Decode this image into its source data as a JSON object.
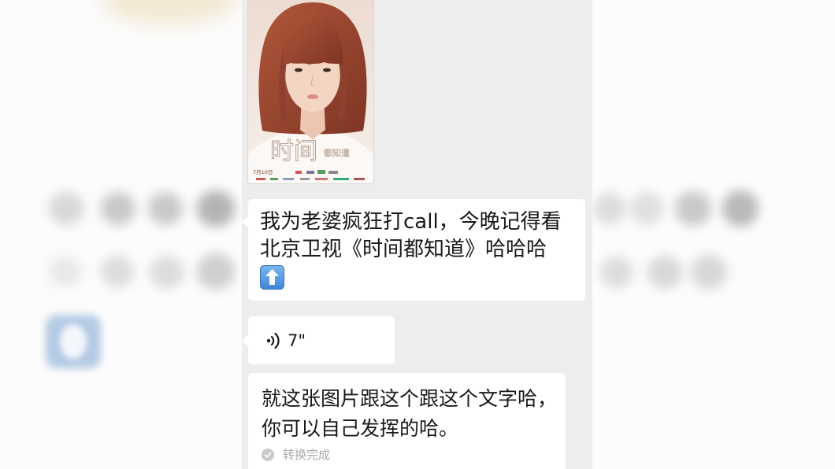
{
  "chat": {
    "image_message": {
      "poster": {
        "title_main": "时间",
        "title_sub": "都知道",
        "date": "7月10日"
      }
    },
    "text_message": {
      "lines": [
        "我为老婆疯狂打call，今晚记得看",
        "北京卫视《时间都知道》哈哈哈"
      ],
      "emoji_icon": "up-arrow-emoji-icon"
    },
    "voice_message": {
      "icon": "voice-wave-icon",
      "duration": "7\""
    },
    "voice_transcript": {
      "lines": [
        "就这张图片跟这个跟这个文字哈，",
        "你可以自己发挥的哈。"
      ],
      "status_icon": "check-circle-icon",
      "status_text": "转换完成"
    }
  },
  "colors": {
    "chat_background": "#ededed",
    "bubble": "#ffffff",
    "message_text": "#191919",
    "status_text": "#a8a8a8",
    "emoji_blue": "#4f95e0",
    "hair": "#9c4a32"
  }
}
